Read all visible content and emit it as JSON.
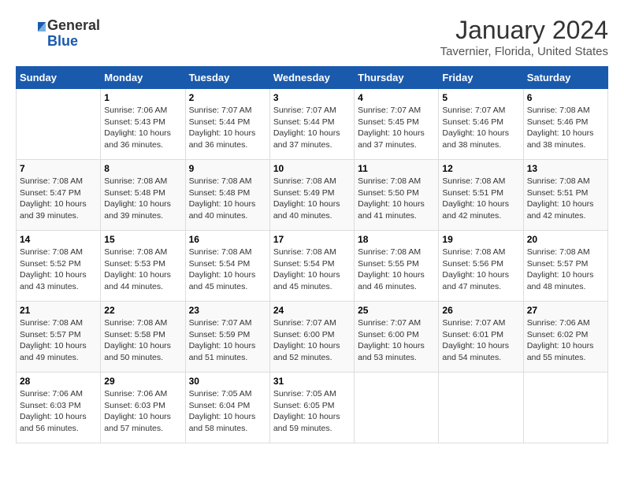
{
  "logo": {
    "general": "General",
    "blue": "Blue"
  },
  "title": "January 2024",
  "subtitle": "Tavernier, Florida, United States",
  "days_of_week": [
    "Sunday",
    "Monday",
    "Tuesday",
    "Wednesday",
    "Thursday",
    "Friday",
    "Saturday"
  ],
  "weeks": [
    [
      {
        "number": "",
        "sunrise": "",
        "sunset": "",
        "daylight": ""
      },
      {
        "number": "1",
        "sunrise": "Sunrise: 7:06 AM",
        "sunset": "Sunset: 5:43 PM",
        "daylight": "Daylight: 10 hours and 36 minutes."
      },
      {
        "number": "2",
        "sunrise": "Sunrise: 7:07 AM",
        "sunset": "Sunset: 5:44 PM",
        "daylight": "Daylight: 10 hours and 36 minutes."
      },
      {
        "number": "3",
        "sunrise": "Sunrise: 7:07 AM",
        "sunset": "Sunset: 5:44 PM",
        "daylight": "Daylight: 10 hours and 37 minutes."
      },
      {
        "number": "4",
        "sunrise": "Sunrise: 7:07 AM",
        "sunset": "Sunset: 5:45 PM",
        "daylight": "Daylight: 10 hours and 37 minutes."
      },
      {
        "number": "5",
        "sunrise": "Sunrise: 7:07 AM",
        "sunset": "Sunset: 5:46 PM",
        "daylight": "Daylight: 10 hours and 38 minutes."
      },
      {
        "number": "6",
        "sunrise": "Sunrise: 7:08 AM",
        "sunset": "Sunset: 5:46 PM",
        "daylight": "Daylight: 10 hours and 38 minutes."
      }
    ],
    [
      {
        "number": "7",
        "sunrise": "Sunrise: 7:08 AM",
        "sunset": "Sunset: 5:47 PM",
        "daylight": "Daylight: 10 hours and 39 minutes."
      },
      {
        "number": "8",
        "sunrise": "Sunrise: 7:08 AM",
        "sunset": "Sunset: 5:48 PM",
        "daylight": "Daylight: 10 hours and 39 minutes."
      },
      {
        "number": "9",
        "sunrise": "Sunrise: 7:08 AM",
        "sunset": "Sunset: 5:48 PM",
        "daylight": "Daylight: 10 hours and 40 minutes."
      },
      {
        "number": "10",
        "sunrise": "Sunrise: 7:08 AM",
        "sunset": "Sunset: 5:49 PM",
        "daylight": "Daylight: 10 hours and 40 minutes."
      },
      {
        "number": "11",
        "sunrise": "Sunrise: 7:08 AM",
        "sunset": "Sunset: 5:50 PM",
        "daylight": "Daylight: 10 hours and 41 minutes."
      },
      {
        "number": "12",
        "sunrise": "Sunrise: 7:08 AM",
        "sunset": "Sunset: 5:51 PM",
        "daylight": "Daylight: 10 hours and 42 minutes."
      },
      {
        "number": "13",
        "sunrise": "Sunrise: 7:08 AM",
        "sunset": "Sunset: 5:51 PM",
        "daylight": "Daylight: 10 hours and 42 minutes."
      }
    ],
    [
      {
        "number": "14",
        "sunrise": "Sunrise: 7:08 AM",
        "sunset": "Sunset: 5:52 PM",
        "daylight": "Daylight: 10 hours and 43 minutes."
      },
      {
        "number": "15",
        "sunrise": "Sunrise: 7:08 AM",
        "sunset": "Sunset: 5:53 PM",
        "daylight": "Daylight: 10 hours and 44 minutes."
      },
      {
        "number": "16",
        "sunrise": "Sunrise: 7:08 AM",
        "sunset": "Sunset: 5:54 PM",
        "daylight": "Daylight: 10 hours and 45 minutes."
      },
      {
        "number": "17",
        "sunrise": "Sunrise: 7:08 AM",
        "sunset": "Sunset: 5:54 PM",
        "daylight": "Daylight: 10 hours and 45 minutes."
      },
      {
        "number": "18",
        "sunrise": "Sunrise: 7:08 AM",
        "sunset": "Sunset: 5:55 PM",
        "daylight": "Daylight: 10 hours and 46 minutes."
      },
      {
        "number": "19",
        "sunrise": "Sunrise: 7:08 AM",
        "sunset": "Sunset: 5:56 PM",
        "daylight": "Daylight: 10 hours and 47 minutes."
      },
      {
        "number": "20",
        "sunrise": "Sunrise: 7:08 AM",
        "sunset": "Sunset: 5:57 PM",
        "daylight": "Daylight: 10 hours and 48 minutes."
      }
    ],
    [
      {
        "number": "21",
        "sunrise": "Sunrise: 7:08 AM",
        "sunset": "Sunset: 5:57 PM",
        "daylight": "Daylight: 10 hours and 49 minutes."
      },
      {
        "number": "22",
        "sunrise": "Sunrise: 7:08 AM",
        "sunset": "Sunset: 5:58 PM",
        "daylight": "Daylight: 10 hours and 50 minutes."
      },
      {
        "number": "23",
        "sunrise": "Sunrise: 7:07 AM",
        "sunset": "Sunset: 5:59 PM",
        "daylight": "Daylight: 10 hours and 51 minutes."
      },
      {
        "number": "24",
        "sunrise": "Sunrise: 7:07 AM",
        "sunset": "Sunset: 6:00 PM",
        "daylight": "Daylight: 10 hours and 52 minutes."
      },
      {
        "number": "25",
        "sunrise": "Sunrise: 7:07 AM",
        "sunset": "Sunset: 6:00 PM",
        "daylight": "Daylight: 10 hours and 53 minutes."
      },
      {
        "number": "26",
        "sunrise": "Sunrise: 7:07 AM",
        "sunset": "Sunset: 6:01 PM",
        "daylight": "Daylight: 10 hours and 54 minutes."
      },
      {
        "number": "27",
        "sunrise": "Sunrise: 7:06 AM",
        "sunset": "Sunset: 6:02 PM",
        "daylight": "Daylight: 10 hours and 55 minutes."
      }
    ],
    [
      {
        "number": "28",
        "sunrise": "Sunrise: 7:06 AM",
        "sunset": "Sunset: 6:03 PM",
        "daylight": "Daylight: 10 hours and 56 minutes."
      },
      {
        "number": "29",
        "sunrise": "Sunrise: 7:06 AM",
        "sunset": "Sunset: 6:03 PM",
        "daylight": "Daylight: 10 hours and 57 minutes."
      },
      {
        "number": "30",
        "sunrise": "Sunrise: 7:05 AM",
        "sunset": "Sunset: 6:04 PM",
        "daylight": "Daylight: 10 hours and 58 minutes."
      },
      {
        "number": "31",
        "sunrise": "Sunrise: 7:05 AM",
        "sunset": "Sunset: 6:05 PM",
        "daylight": "Daylight: 10 hours and 59 minutes."
      },
      {
        "number": "",
        "sunrise": "",
        "sunset": "",
        "daylight": ""
      },
      {
        "number": "",
        "sunrise": "",
        "sunset": "",
        "daylight": ""
      },
      {
        "number": "",
        "sunrise": "",
        "sunset": "",
        "daylight": ""
      }
    ]
  ]
}
